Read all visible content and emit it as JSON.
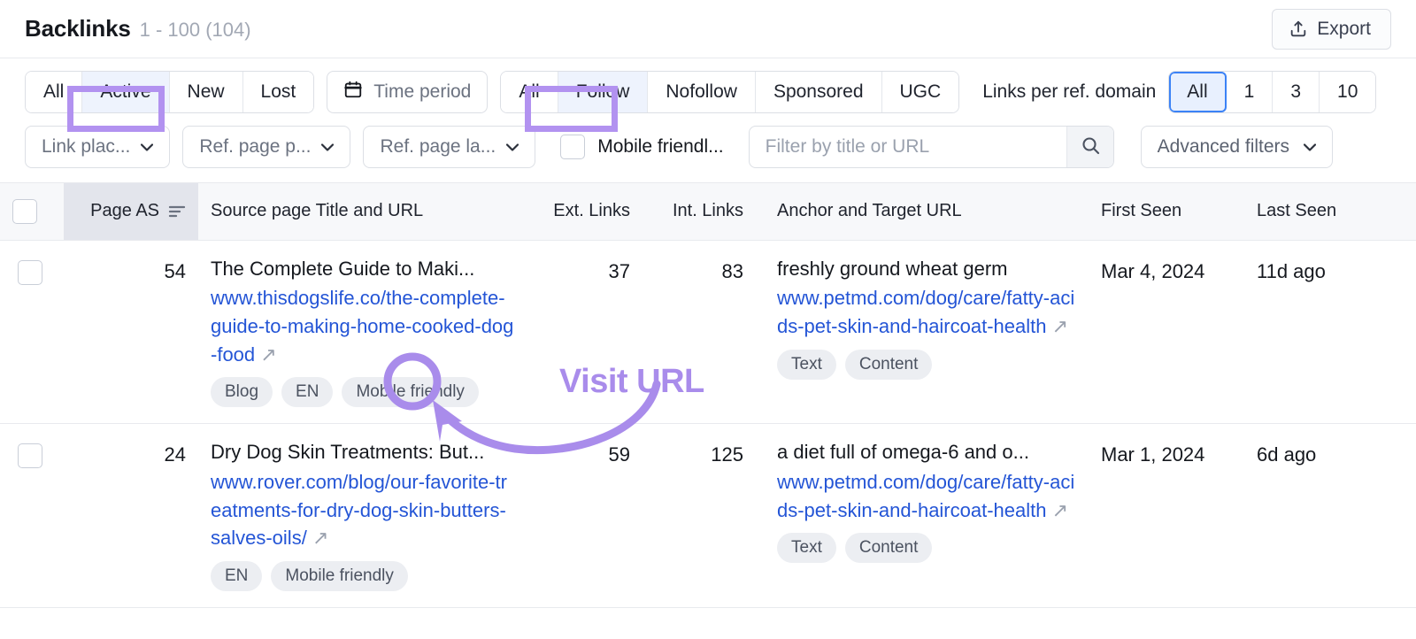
{
  "header": {
    "title": "Backlinks",
    "count": "1 - 100 (104)",
    "export_label": "Export",
    "export_icon": "upload-icon"
  },
  "filters": {
    "status_group": {
      "items": [
        "All",
        "Active",
        "New",
        "Lost"
      ],
      "selected": "Active"
    },
    "time_period": {
      "label": "Time period",
      "icon": "calendar-icon"
    },
    "follow_group": {
      "items": [
        "All",
        "Follow",
        "Nofollow",
        "Sponsored",
        "UGC"
      ],
      "selected": "Follow"
    },
    "links_per_domain": {
      "label": "Links per ref. domain",
      "items": [
        "All",
        "1",
        "3",
        "10"
      ],
      "selected": "All"
    },
    "dropdowns": [
      {
        "label": "Link plac...",
        "icon": "chevron-down-icon"
      },
      {
        "label": "Ref. page p...",
        "icon": "chevron-down-icon"
      },
      {
        "label": "Ref. page la...",
        "icon": "chevron-down-icon"
      }
    ],
    "mobile_friendly": {
      "label": "Mobile friendl...",
      "checked": false
    },
    "search": {
      "placeholder": "Filter by title or URL",
      "value": "",
      "icon": "search-icon"
    },
    "advanced": {
      "label": "Advanced filters",
      "icon": "chevron-down-icon"
    }
  },
  "table": {
    "columns": {
      "page_as": "Page AS",
      "source": "Source page Title and URL",
      "ext_links": "Ext. Links",
      "int_links": "Int. Links",
      "anchor": "Anchor and Target URL",
      "first_seen": "First Seen",
      "last_seen": "Last Seen"
    },
    "sort_icon": "sort-icon",
    "rows": [
      {
        "page_as": "54",
        "source_title": "The Complete Guide to Maki...",
        "source_url": "www.thisdogslife.co/the-complete-guide-to-making-home-cooked-dog-food",
        "source_tags": [
          "Blog",
          "EN",
          "Mobile friendly"
        ],
        "ext_links": "37",
        "int_links": "83",
        "anchor_text": "freshly ground wheat germ",
        "target_url": "www.petmd.com/dog/care/fatty-acids-pet-skin-and-haircoat-health",
        "anchor_tags": [
          "Text",
          "Content"
        ],
        "first_seen": "Mar 4, 2024",
        "last_seen": "11d ago"
      },
      {
        "page_as": "24",
        "source_title": "Dry Dog Skin Treatments: But...",
        "source_url": "www.rover.com/blog/our-favorite-treatments-for-dry-dog-skin-butters-salves-oils/",
        "source_tags": [
          "EN",
          "Mobile friendly"
        ],
        "ext_links": "59",
        "int_links": "125",
        "anchor_text": "a diet full of omega-6 and o...",
        "target_url": "www.petmd.com/dog/care/fatty-acids-pet-skin-and-haircoat-health",
        "anchor_tags": [
          "Text",
          "Content"
        ],
        "first_seen": "Mar 1, 2024",
        "last_seen": "6d ago"
      }
    ]
  },
  "annotations": {
    "callout_label": "Visit URL",
    "color": "#a98ceb",
    "highlight_boxes": [
      "Active",
      "Follow"
    ]
  }
}
